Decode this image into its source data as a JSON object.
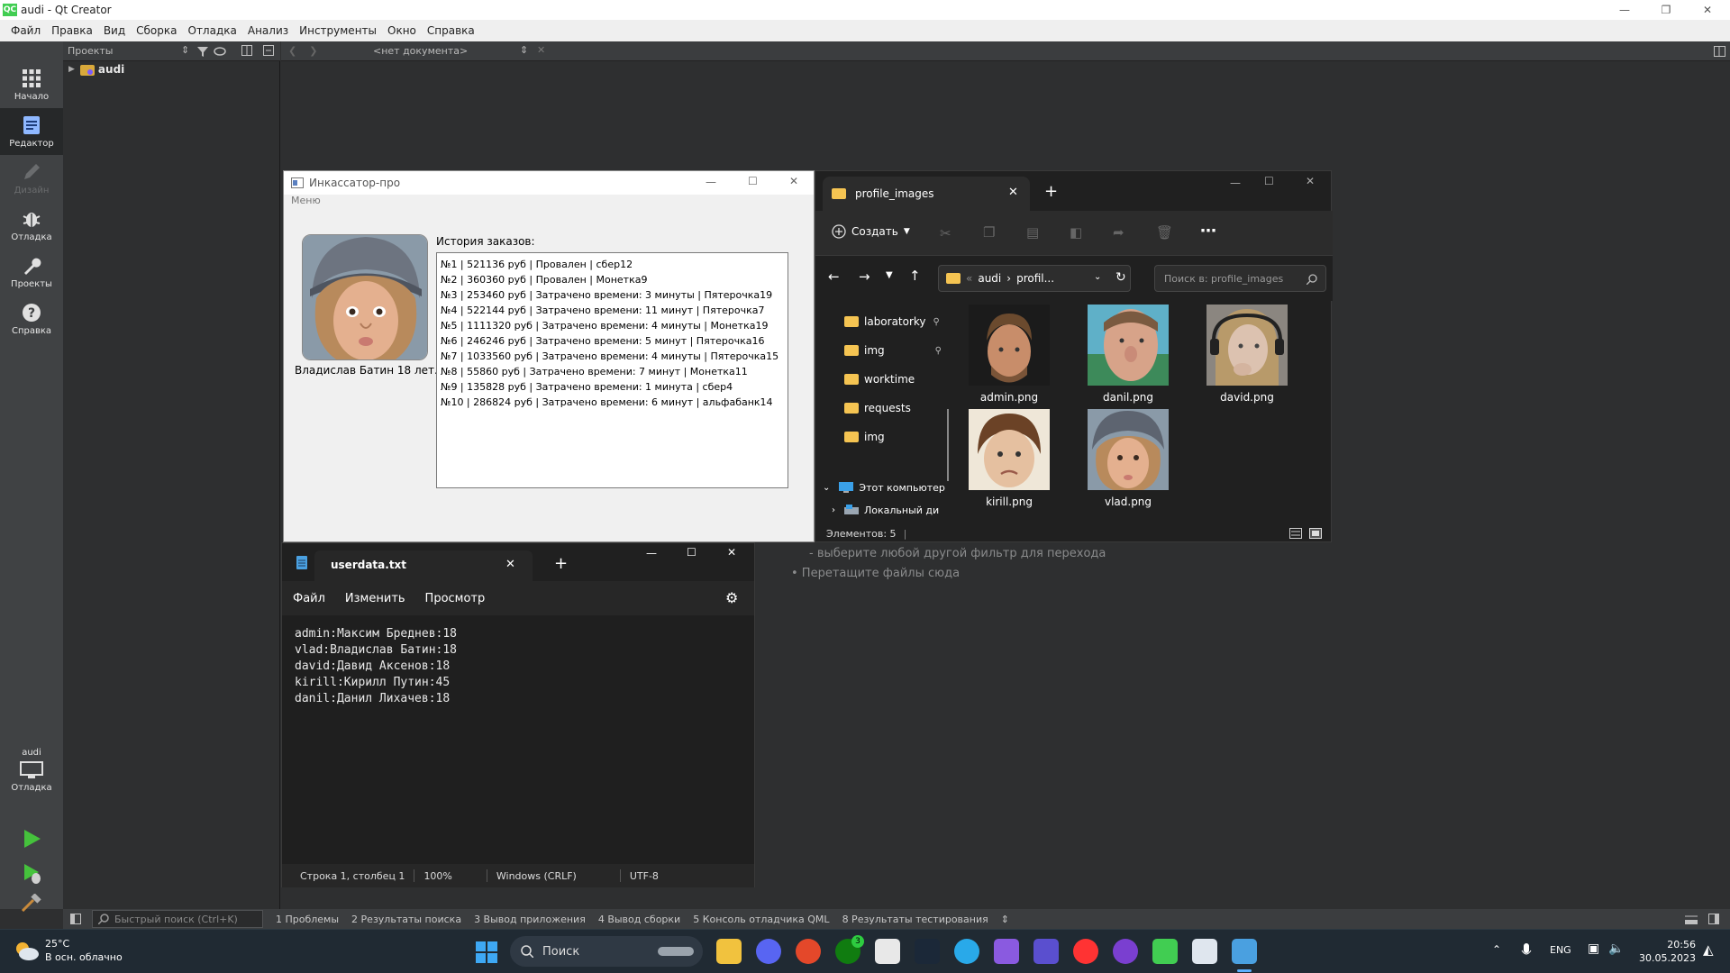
{
  "window": {
    "title": "audi - Qt Creator"
  },
  "menubar": [
    "Файл",
    "Правка",
    "Вид",
    "Сборка",
    "Отладка",
    "Анализ",
    "Инструменты",
    "Окно",
    "Справка"
  ],
  "modebar": {
    "items": [
      "Начало",
      "Редактор",
      "Дизайн",
      "Отладка",
      "Проекты",
      "Справка"
    ],
    "kit_project": "audi",
    "kit_label": "Отладка"
  },
  "projects_panel": {
    "title": "Проекты",
    "tree_root": "audi"
  },
  "editor_toolbar": {
    "document": "<нет документа>"
  },
  "editor_hints": [
    "- выберите любой другой фильтр для перехода",
    "• Перетащите файлы сюда"
  ],
  "output_bar": {
    "search_placeholder": "Быстрый поиск (Ctrl+K)",
    "tabs": [
      "1  Проблемы",
      "2  Результаты поиска",
      "3  Вывод приложения",
      "4  Вывод сборки",
      "5  Консоль отладчика QML",
      "8  Результаты тестирования"
    ]
  },
  "app_window": {
    "title": "Инкассатор-про",
    "menu": "Меню",
    "user_caption": "Владислав Батин 18 лет.",
    "history_title": "История заказов:",
    "history": [
      "№1 | 521136 руб | Провален | сбер12",
      "№2 | 360360 руб | Провален | Монетка9",
      "№3 | 253460 руб | Затрачено времени: 3 минуты | Пятерочка19",
      "№4 | 522144 руб | Затрачено времени: 11 минут | Пятерочка7",
      "№5 | 1111320 руб | Затрачено времени: 4 минуты | Монетка19",
      "№6 | 246246 руб | Затрачено времени: 5 минут | Пятерочка16",
      "№7 | 1033560 руб | Затрачено времени: 4 минуты | Пятерочка15",
      "№8 | 55860 руб | Затрачено времени: 7 минут | Монетка11",
      "№9 | 135828 руб | Затрачено времени: 1 минута | сбер4",
      "№10 | 286824 руб | Затрачено времени: 6 минут | альфабанк14"
    ]
  },
  "explorer": {
    "tab_title": "profile_images",
    "create_label": "Создать",
    "breadcrumb": [
      "audi",
      "profil..."
    ],
    "search_placeholder": "Поиск в: profile_images",
    "nav": [
      "laboratorky",
      "img",
      "worktime",
      "requests",
      "img"
    ],
    "this_pc": "Этот компьютер",
    "local_disk": "Локальный ди",
    "files": [
      "admin.png",
      "danil.png",
      "david.png",
      "kirill.png",
      "vlad.png"
    ],
    "status": "Элементов: 5"
  },
  "notepad": {
    "tab_title": "userdata.txt",
    "menu": [
      "Файл",
      "Изменить",
      "Просмотр"
    ],
    "lines": [
      "admin:Максим Бреднев:18",
      "vlad:Владислав Батин:18",
      "david:Давид Аксенов:18",
      "kirill:Кирилл Путин:45",
      "danil:Данил Лихачев:18"
    ],
    "status": {
      "position": "Строка 1, столбец 1",
      "zoom": "100%",
      "line_ending": "Windows (CRLF)",
      "encoding": "UTF-8"
    }
  },
  "taskbar": {
    "weather_temp": "25°C",
    "weather_desc": "В осн. облачно",
    "search_label": "Поиск",
    "xbox_badge": "3",
    "lang": "ENG",
    "time": "20:56",
    "date": "30.05.2023"
  },
  "colors": {
    "qt_green": "#41cd52",
    "modebar": "#404244",
    "taskbar": "#202a33",
    "folder": "#f5c452"
  }
}
